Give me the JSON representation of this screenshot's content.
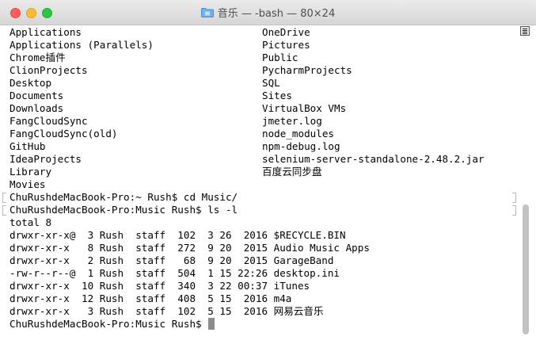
{
  "window": {
    "title": "音乐 — -bash — 80×24",
    "folder_icon": "folder-icon"
  },
  "listing": [
    [
      "Applications",
      "OneDrive"
    ],
    [
      "Applications (Parallels)",
      "Pictures"
    ],
    [
      "Chrome插件",
      "Public"
    ],
    [
      "ClionProjects",
      "PycharmProjects"
    ],
    [
      "Desktop",
      "SQL"
    ],
    [
      "Documents",
      "Sites"
    ],
    [
      "Downloads",
      "VirtualBox VMs"
    ],
    [
      "FangCloudSync",
      "jmeter.log"
    ],
    [
      "FangCloudSync(old)",
      "node_modules"
    ],
    [
      "GitHub",
      "npm-debug.log"
    ],
    [
      "IdeaProjects",
      "selenium-server-standalone-2.48.2.jar"
    ],
    [
      "Library",
      "百度云同步盘"
    ],
    [
      "Movies",
      ""
    ]
  ],
  "commands": [
    "ChuRushdeMacBook-Pro:~ Rush$ cd Music/",
    "ChuRushdeMacBook-Pro:Music Rush$ ls -l"
  ],
  "ls_output": [
    "total 8",
    "drwxr-xr-x@  3 Rush  staff  102  3 26  2016 $RECYCLE.BIN",
    "drwxr-xr-x   8 Rush  staff  272  9 20  2015 Audio Music Apps",
    "drwxr-xr-x   2 Rush  staff   68  9 20  2015 GarageBand",
    "-rw-r--r--@  1 Rush  staff  504  1 15 22:26 desktop.ini",
    "drwxr-xr-x  10 Rush  staff  340  3 22 00:37 iTunes",
    "drwxr-xr-x  12 Rush  staff  408  5 15  2016 m4a",
    "drwxr-xr-x   3 Rush  staff  102  5 15  2016 网易云音乐"
  ],
  "prompt": "ChuRushdeMacBook-Pro:Music Rush$ "
}
